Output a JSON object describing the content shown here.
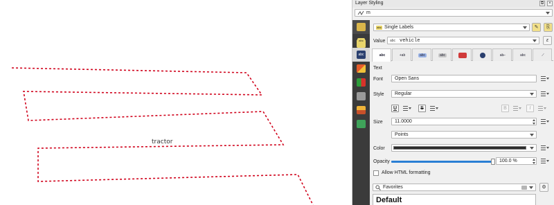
{
  "map": {
    "feature_label": "tractor",
    "line_color": "#d0021b"
  },
  "panel": {
    "title": "Layer Styling",
    "layer_combo": "m",
    "layer_icon": "line-layer-icon",
    "renderer": "Single Labels",
    "value_label": "Value",
    "value_field": "vehicle",
    "sidebar_icons": [
      "labels-abc-icon",
      "3d-view-icon",
      "diagrams-icon",
      "mask-icon",
      "rendering-icon",
      "actions-icon"
    ],
    "tabs": [
      "text-tab",
      "formatting-tab",
      "buffer-tab",
      "mask-tab",
      "background-tab",
      "shadow-tab",
      "callouts-tab",
      "placement-tab",
      "rendering-tab"
    ],
    "text_section": {
      "heading": "Text",
      "font_label": "Font",
      "font_value": "Open Sans",
      "style_label": "Style",
      "style_value": "Regular",
      "underline": "U",
      "strike": "S",
      "bold": "B",
      "italic": "I",
      "size_label": "Size",
      "size_value": "11.0000",
      "unit_value": "Points",
      "color_label": "Color",
      "color_value": "#2b2b2b",
      "opacity_label": "Opacity",
      "opacity_value": "100.0 %",
      "opacity_fraction": 1.0,
      "html_label": "Allow HTML formatting"
    },
    "favorites": {
      "search_placeholder": "Favorites",
      "default_heading": "Default"
    }
  }
}
